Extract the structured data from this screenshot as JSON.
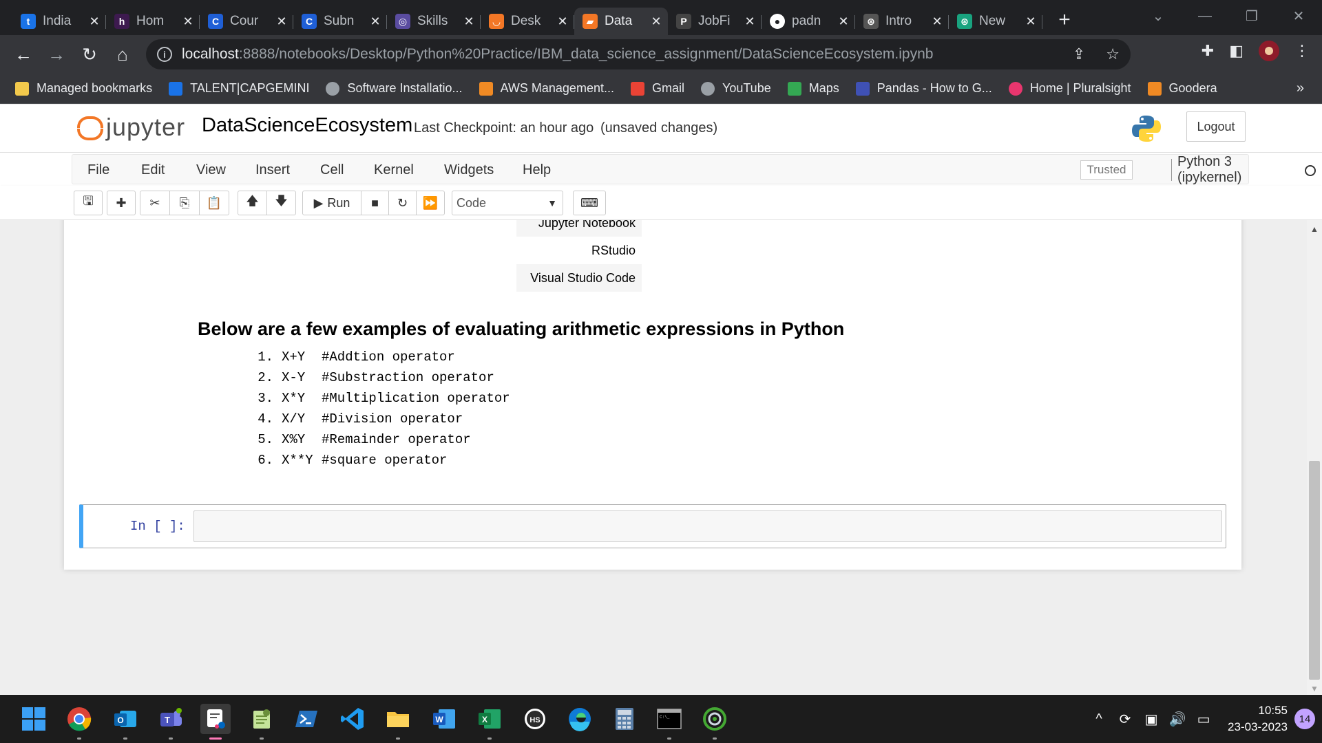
{
  "browser": {
    "tabs": [
      {
        "title": "India",
        "favicon": "t",
        "color": "#1a73e8",
        "active": false
      },
      {
        "title": "Hom",
        "favicon": "h",
        "color": "#3d1a4f",
        "active": false
      },
      {
        "title": "Cour",
        "favicon": "C",
        "color": "#1f5fd6",
        "active": false
      },
      {
        "title": "Subn",
        "favicon": "C",
        "color": "#1f5fd6",
        "active": false
      },
      {
        "title": "Skills",
        "favicon": "◎",
        "color": "#5a4ca0",
        "active": false
      },
      {
        "title": "Desk",
        "favicon": "◡",
        "color": "#f37726",
        "active": false
      },
      {
        "title": "Data",
        "favicon": "▰",
        "color": "#f37726",
        "active": true
      },
      {
        "title": "JobFi",
        "favicon": "P",
        "color": "#444",
        "active": false
      },
      {
        "title": "padn",
        "favicon": "●",
        "color": "#fff",
        "active": false
      },
      {
        "title": "Intro",
        "favicon": "⊛",
        "color": "#555",
        "active": false
      },
      {
        "title": "New",
        "favicon": "⊛",
        "color": "#19a37f",
        "active": false
      }
    ],
    "url_host": "localhost",
    "url_path": ":8888/notebooks/Desktop/Python%20Practice/IBM_data_science_assignment/DataScienceEcosystem.ipynb",
    "bookmarks": [
      {
        "label": "Managed bookmarks",
        "icon": "folder-icon",
        "color": "#f2c94c"
      },
      {
        "label": "TALENT|CAPGEMINI",
        "icon": "talent-icon",
        "color": "#1a73e8"
      },
      {
        "label": "Software Installatio...",
        "icon": "software-icon",
        "color": "#9aa0a6"
      },
      {
        "label": "AWS Management...",
        "icon": "aws-icon",
        "color": "#f08a24"
      },
      {
        "label": "Gmail",
        "icon": "gmail-icon",
        "color": "#ea4335"
      },
      {
        "label": "YouTube",
        "icon": "globe-icon",
        "color": "#9aa0a6"
      },
      {
        "label": "Maps",
        "icon": "maps-icon",
        "color": "#34a853"
      },
      {
        "label": "Pandas - How to G...",
        "icon": "pandas-icon",
        "color": "#3f51b5"
      },
      {
        "label": "Home | Pluralsight",
        "icon": "pluralsight-icon",
        "color": "#e8366e"
      },
      {
        "label": "Goodera",
        "icon": "goodera-icon",
        "color": "#f08a24"
      }
    ],
    "more": "»"
  },
  "jupyter": {
    "logo_text": "jupyter",
    "notebook_name": "DataScienceEcosystem",
    "checkpoint": "Last Checkpoint: an hour ago",
    "unsaved": "(unsaved changes)",
    "logout": "Logout",
    "menu": [
      "File",
      "Edit",
      "View",
      "Insert",
      "Cell",
      "Kernel",
      "Widgets",
      "Help"
    ],
    "trusted": "Trusted",
    "kernel": "Python 3 (ipykernel)",
    "run_label": "Run",
    "cell_type": "Code"
  },
  "notebook": {
    "table_rows": [
      "Jupyter Notebook",
      "RStudio",
      "Visual Studio Code"
    ],
    "heading": "Below are a few examples of evaluating arithmetic expressions in Python",
    "expressions": [
      {
        "num": "1.",
        "expr": "X+Y",
        "comment": "#Addtion operator"
      },
      {
        "num": "2.",
        "expr": "X-Y",
        "comment": "#Substraction operator"
      },
      {
        "num": "3.",
        "expr": "X*Y",
        "comment": "#Multiplication operator"
      },
      {
        "num": "4.",
        "expr": "X/Y",
        "comment": "#Division operator"
      },
      {
        "num": "5.",
        "expr": "X%Y",
        "comment": "#Remainder operator"
      },
      {
        "num": "6.",
        "expr": "X**Y",
        "comment": "#square operator"
      }
    ],
    "prompt": "In [ ]:"
  },
  "taskbar": {
    "time": "10:55",
    "date": "23-03-2023",
    "notifications": "14"
  }
}
